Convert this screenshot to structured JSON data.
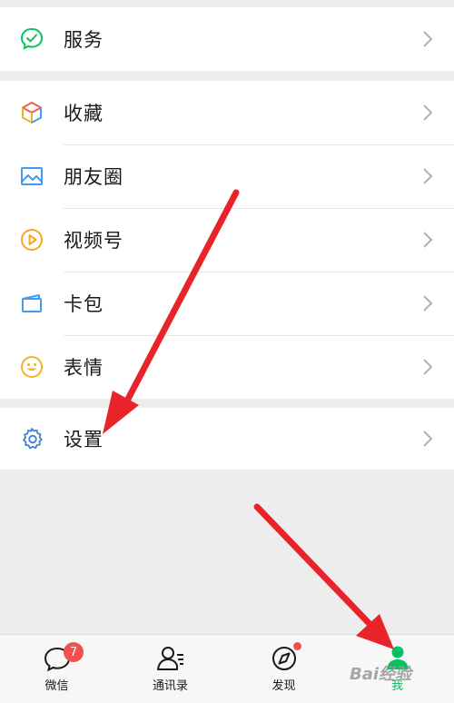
{
  "menu": {
    "service_label": "服务",
    "items": [
      {
        "label": "收藏"
      },
      {
        "label": "朋友圈"
      },
      {
        "label": "视频号"
      },
      {
        "label": "卡包"
      },
      {
        "label": "表情"
      }
    ],
    "settings_label": "设置"
  },
  "tabbar": {
    "tabs": [
      {
        "label": "微信",
        "badge": "7"
      },
      {
        "label": "通讯录"
      },
      {
        "label": "发现"
      },
      {
        "label": "我"
      }
    ]
  },
  "watermark": "Bai经验",
  "colors": {
    "active": "#07c160",
    "badge": "#f0514f",
    "arrow": "#e8232a"
  }
}
